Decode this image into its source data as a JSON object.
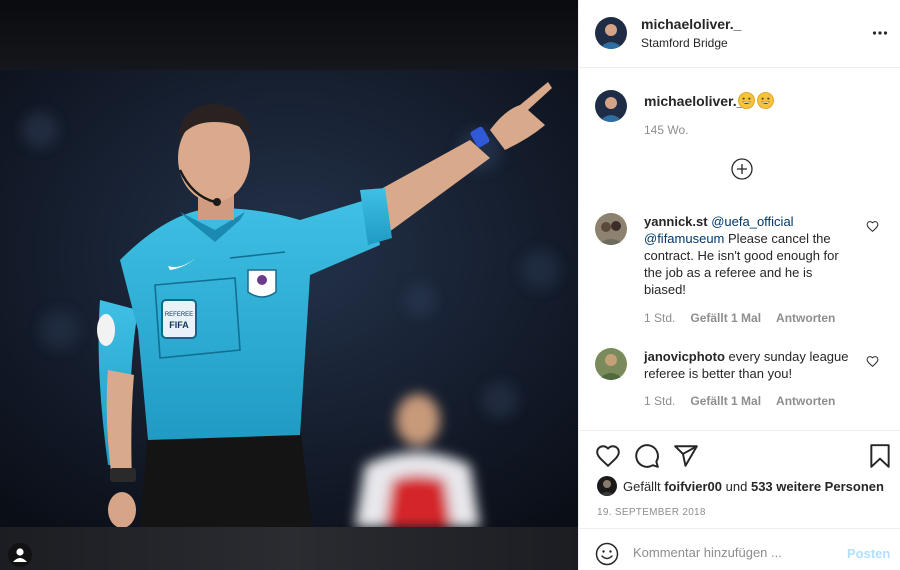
{
  "post": {
    "author": "michaeloliver._",
    "location": "Stamford Bridge",
    "caption_time": "145 Wo.",
    "caption_emoji": [
      "grinning-face-icon",
      "grinning-face-icon"
    ],
    "date": "19. SEPTEMBER 2018"
  },
  "photo": {
    "description_icon": "referee-photo"
  },
  "comments": [
    {
      "user": "yannick.st",
      "mention1": "@uefa_official",
      "mention2": "@fifamuseum",
      "text": "Please cancel the contract. He isn't good enough for the job as a referee and he is biased!",
      "time": "1 Std.",
      "likes": "Gefällt 1 Mal",
      "reply": "Antworten"
    },
    {
      "user": "janovicphoto",
      "text": "every sunday league referee is better than you!",
      "time": "1 Std.",
      "likes": "Gefällt 1 Mal",
      "reply": "Antworten"
    }
  ],
  "likes": {
    "prefix": "Gefällt",
    "first_user": "foifvier00",
    "connector": "und",
    "others": "533 weitere Personen"
  },
  "compose": {
    "placeholder": "Kommentar hinzufügen ...",
    "post_label": "Posten"
  },
  "colors": {
    "link": "#00376b",
    "muted": "#8e8e8e",
    "post_disabled": "#b2dffc",
    "jersey": "#2fb2d6"
  }
}
